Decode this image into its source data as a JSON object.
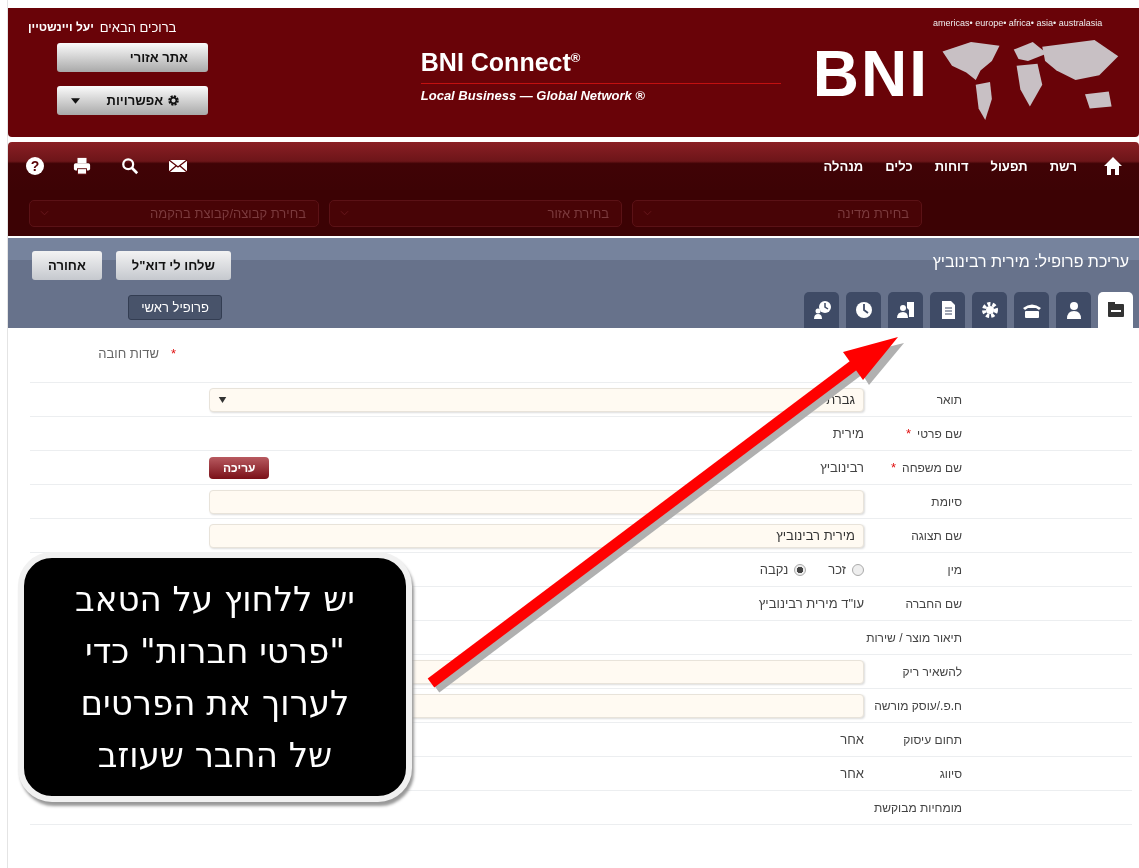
{
  "header": {
    "welcome": "ברוכים הבאים",
    "user": "יעל ויינשטיין",
    "buttons": [
      {
        "kind": "plain",
        "label": "אתר אזורי"
      },
      {
        "kind": "options",
        "label": "אפשרויות"
      }
    ],
    "brand": "BNI Connect",
    "registered": "®",
    "tagline": "Local Business — Global Network ®",
    "logo": "BNI",
    "continents": "americas• europe• africa• asia• australasia"
  },
  "nav": {
    "items": [
      "רשת",
      "תפעול",
      "דוחות",
      "כלים",
      "מנהלה"
    ],
    "help": "?"
  },
  "filters": [
    {
      "placeholder": "בחירת מדינה"
    },
    {
      "placeholder": "בחירת אזור"
    },
    {
      "placeholder": "בחירת קבוצה/קבוצת בהקמה"
    }
  ],
  "profile": {
    "title": "עריכת פרופיל: מירית רבינוביץ",
    "buttons": [
      "שלחו לי דוא\"ל",
      "אחורה"
    ],
    "main_profile": "פרופיל ראשי",
    "tabs": [
      {
        "kind": "card",
        "selected": true
      },
      {
        "kind": "person",
        "selected": false
      },
      {
        "kind": "phone",
        "selected": false
      },
      {
        "kind": "gear",
        "selected": false
      },
      {
        "kind": "document",
        "selected": false
      },
      {
        "kind": "contacts",
        "selected": false
      },
      {
        "kind": "clock",
        "selected": false
      },
      {
        "kind": "history",
        "selected": false
      }
    ]
  },
  "form": {
    "required_mark": "*",
    "required_note": "שדות חובה",
    "rows": [
      {
        "kind": "select",
        "label": "תואר",
        "required": false,
        "value": "גברת"
      },
      {
        "kind": "text",
        "label": "שם פרטי",
        "required": true,
        "value": "מירית"
      },
      {
        "kind": "text",
        "label": "שם משפחה",
        "required": true,
        "value": "רבינוביץ",
        "action": "עריכה"
      },
      {
        "kind": "input",
        "label": "סיומת",
        "required": false
      },
      {
        "kind": "input",
        "label": "שם תצוגה",
        "required": false,
        "value": "מירית רבינוביץ"
      },
      {
        "kind": "radio",
        "label": "מין",
        "required": false,
        "options": [
          {
            "label": "זכר",
            "selected": false
          },
          {
            "label": "נקבה",
            "selected": true
          }
        ]
      },
      {
        "kind": "text",
        "label": "שם החברה",
        "required": false,
        "value": "עו\"ד מירית רבינוביץ"
      },
      {
        "kind": "text",
        "label": "תיאור מוצר / שירות",
        "required": false
      },
      {
        "kind": "input",
        "label": "להשאיר ריק",
        "required": false
      },
      {
        "kind": "input",
        "label": "ח.פ./עוסק מורשה",
        "required": false
      },
      {
        "kind": "text",
        "label": "תחום עיסוק",
        "required": false,
        "value": "אחר"
      },
      {
        "kind": "text",
        "label": "סיווג",
        "required": false,
        "value": "אחר"
      },
      {
        "kind": "text",
        "label": "מומחיות מבוקשת",
        "required": false
      }
    ]
  },
  "callout": {
    "lines": [
      "יש ללחוץ על הטאב",
      "\"פרטי חברות\" כדי",
      "לערוך את הפרטים",
      "של החבר שעוזב"
    ]
  }
}
